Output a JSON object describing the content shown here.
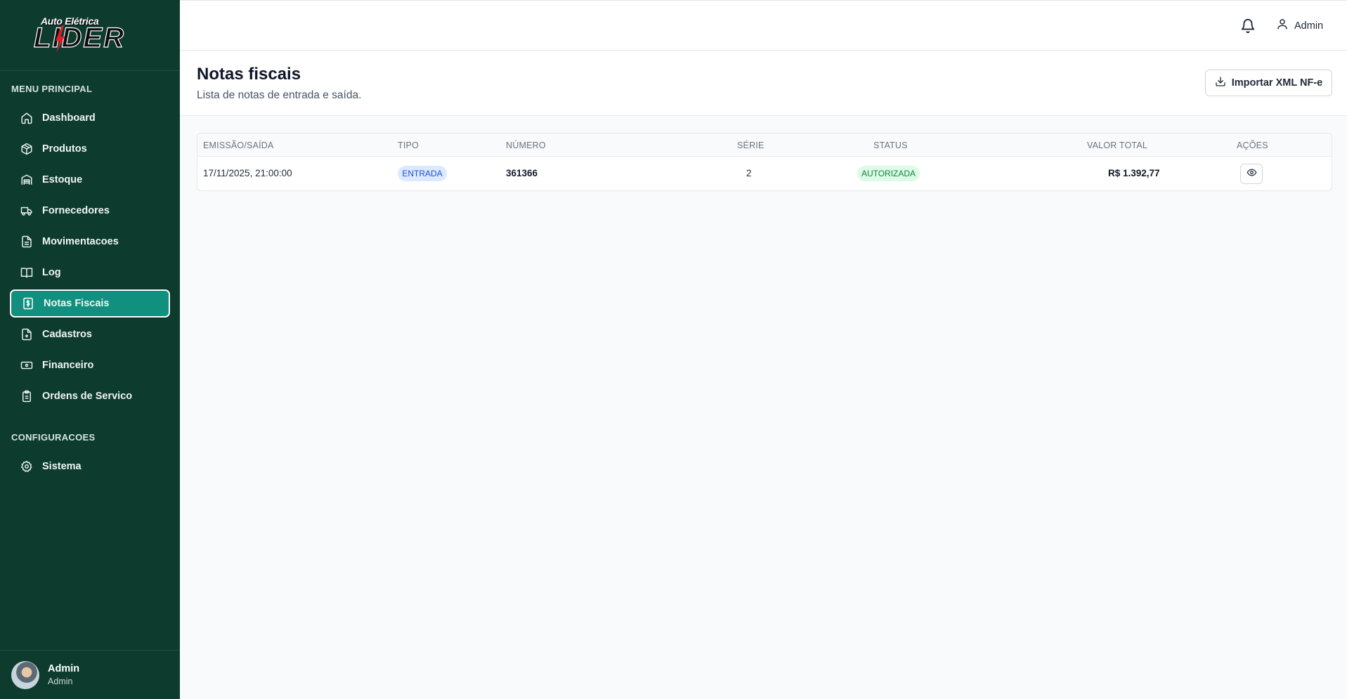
{
  "brand": {
    "logo_top": "Auto Elétrica",
    "logo_main": "LIDER"
  },
  "sidebar": {
    "section_main": "MENU PRINCIPAL",
    "items": [
      {
        "label": "Dashboard",
        "icon": "home-icon"
      },
      {
        "label": "Produtos",
        "icon": "package-icon"
      },
      {
        "label": "Estoque",
        "icon": "warehouse-icon"
      },
      {
        "label": "Fornecedores",
        "icon": "truck-icon"
      },
      {
        "label": "Movimentacoes",
        "icon": "document-icon"
      },
      {
        "label": "Log",
        "icon": "book-icon"
      },
      {
        "label": "Notas Fiscais",
        "icon": "receipt-dollar-icon",
        "active": true
      },
      {
        "label": "Cadastros",
        "icon": "file-plus-icon"
      },
      {
        "label": "Financeiro",
        "icon": "banknote-icon"
      },
      {
        "label": "Ordens de Servico",
        "icon": "clipboard-icon"
      }
    ],
    "section_config": "CONFIGURACOES",
    "config_items": [
      {
        "label": "Sistema",
        "icon": "gear-icon"
      }
    ],
    "user": {
      "name": "Admin",
      "role": "Admin"
    }
  },
  "header": {
    "user_label": "Admin"
  },
  "page": {
    "title": "Notas fiscais",
    "subtitle": "Lista de notas de entrada e saída.",
    "import_label": "Importar XML NF-e"
  },
  "table": {
    "columns": [
      "EMISSÃO/SAÍDA",
      "TIPO",
      "NÚMERO",
      "SÉRIE",
      "STATUS",
      "VALOR TOTAL",
      "AÇÕES"
    ],
    "rows": [
      {
        "date": "17/11/2025, 21:00:00",
        "tipo": "ENTRADA",
        "numero": "361366",
        "serie": "2",
        "status": "AUTORIZADA",
        "valor": "R$ 1.392,77"
      }
    ]
  },
  "colors": {
    "sidebar_bg": "#0d3b2e",
    "active_item": "#11907f",
    "tipo_badge": "#dbeafe",
    "status_badge": "#dcfce7"
  }
}
